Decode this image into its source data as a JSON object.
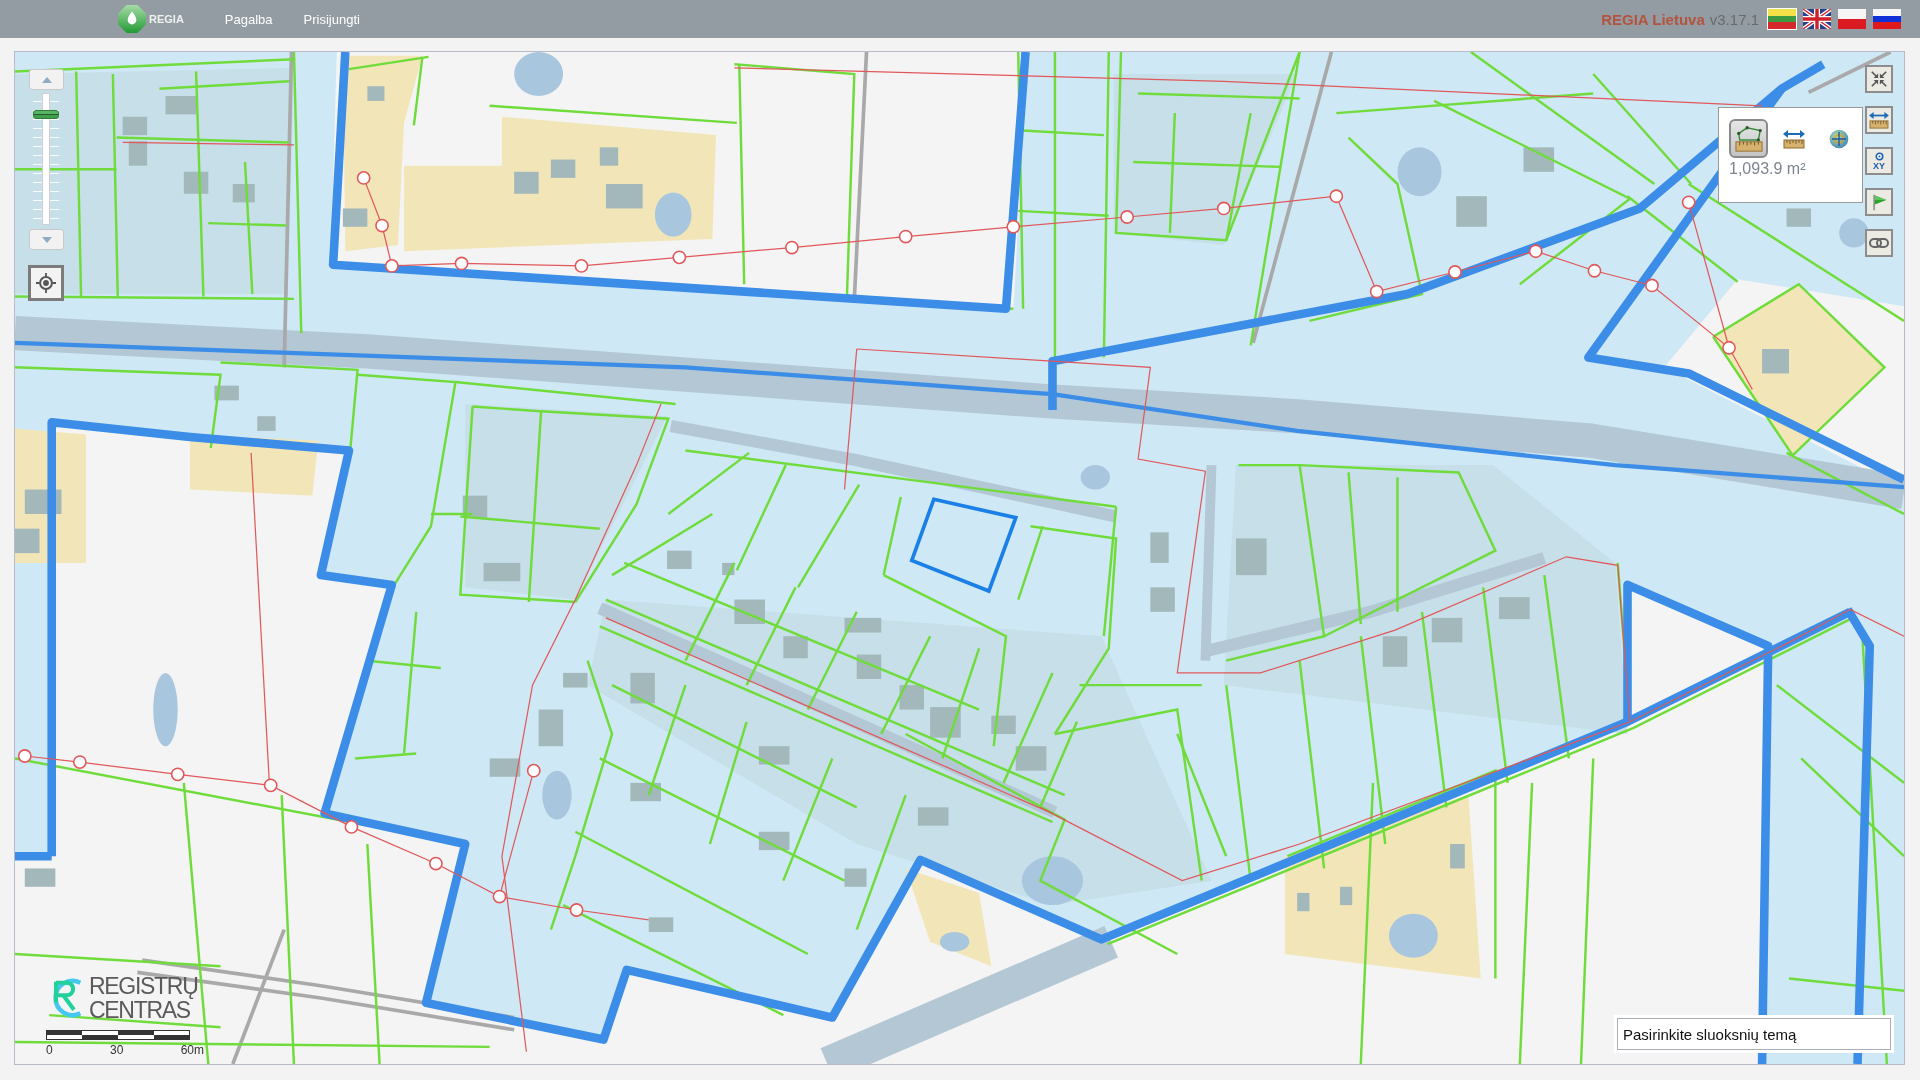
{
  "header": {
    "logo_text": "REGIA",
    "menu": [
      {
        "label": "Pagalba"
      },
      {
        "label": "Prisijungti"
      }
    ],
    "brand": "REGIA Lietuva",
    "version": "v3.17.1",
    "languages": [
      {
        "kind": "lt",
        "selected": true
      },
      {
        "kind": "en",
        "selected": false
      },
      {
        "kind": "pl",
        "selected": false
      },
      {
        "kind": "ru",
        "selected": false
      }
    ]
  },
  "map": {
    "zoom": {
      "level": 0.86
    },
    "toolbar": [
      {
        "kind": "collapse"
      },
      {
        "kind": "measure"
      },
      {
        "kind": "coordinates",
        "label": "XY"
      },
      {
        "kind": "flag"
      },
      {
        "kind": "link"
      }
    ],
    "measure_popup": {
      "tools": [
        {
          "kind": "area",
          "selected": true
        },
        {
          "kind": "distance",
          "selected": false
        },
        {
          "kind": "locate",
          "selected": false
        }
      ],
      "reading": "1,093.9 m²"
    },
    "attribution": {
      "lines": [
        "REGISTRŲ",
        "CENTRAS"
      ]
    },
    "scale": {
      "labels": [
        "0",
        "30",
        "60m"
      ]
    },
    "layer_select": {
      "value": "Pasirinkite sluoksnių temą"
    }
  }
}
